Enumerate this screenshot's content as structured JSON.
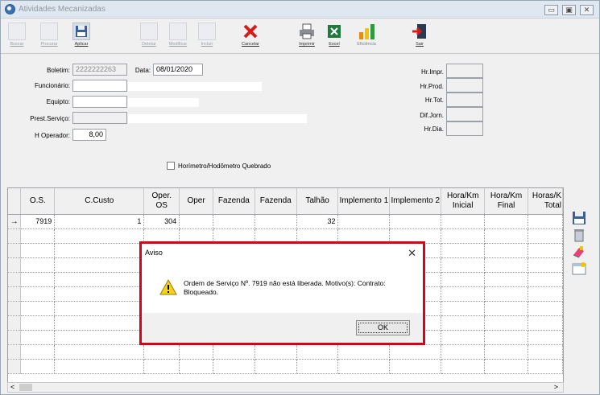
{
  "window": {
    "title": "Atividades Mecanizadas"
  },
  "toolbar": {
    "buscar": "Buscar",
    "procurar": "Procurar",
    "aplicar": "Aplicar",
    "deletar": "Deletar",
    "modificar": "Modificar",
    "incluir": "Incluir",
    "cancelar": "Cancelar",
    "imprimir": "Imprimir",
    "excel": "Excel",
    "eficiencia": "Eficiência",
    "sair": "Sair"
  },
  "form": {
    "boletim_label": "Boletim:",
    "boletim_value": "2222222263",
    "data_label": "Data:",
    "data_value": "08/01/2020",
    "funcionario_label": "Funcionário:",
    "equipto_label": "Equipto:",
    "prest_label": "Prest.Serviço:",
    "hoperador_label": "H Operador:",
    "hoperador_value": "8,00",
    "hr_impr": "Hr.Impr.",
    "hr_prod": "Hr.Prod.",
    "hr_tot": "Hr.Tot.",
    "dif_jorn": "Dif.Jorn.",
    "hr_dia": "Hr.Dia.",
    "horimetro_label": "Horímetro/Hodômetro Quebrado"
  },
  "grid": {
    "headers": {
      "os": "O.S.",
      "ccusto": "C.Custo",
      "oper_os_1": "Oper.",
      "oper_os_2": "OS",
      "oper": "Oper",
      "fazenda1": "Fazenda",
      "fazenda2": "Fazenda",
      "talhao": "Talhão",
      "impl1": "Implemento 1",
      "impl2": "Implemento 2",
      "hk_ini_1": "Hora/Km",
      "hk_ini_2": "Inicial",
      "hk_fin_1": "Hora/Km",
      "hk_fin_2": "Final",
      "hk_tot_1": "Horas/K",
      "hk_tot_2": "Total"
    },
    "row1": {
      "indicator": "→",
      "os": "7919",
      "ccusto": "1",
      "oper_os": "304",
      "talhao": "32"
    }
  },
  "dialog": {
    "title": "Aviso",
    "message": "Ordem de Serviço Nº. 7919 não está liberada. Motivo(s): Contrato: Bloqueado.",
    "ok": "OK",
    "close": "✕"
  },
  "scroll": {
    "left": "<",
    "right": ">"
  },
  "colors": {
    "highlight": "#d9001b",
    "titlebar": "#dfe7f1"
  }
}
